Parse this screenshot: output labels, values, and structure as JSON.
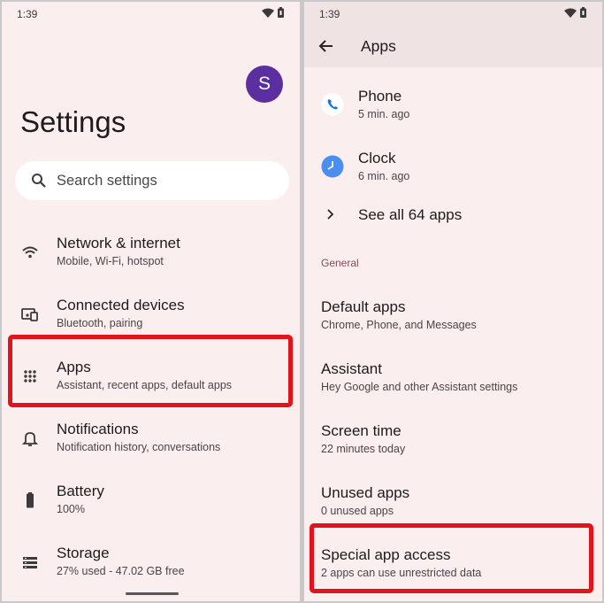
{
  "status": {
    "time": "1:39"
  },
  "left": {
    "avatar_letter": "S",
    "title": "Settings",
    "search_placeholder": "Search settings",
    "items": [
      {
        "icon": "wifi-icon",
        "title": "Network & internet",
        "sub": "Mobile, Wi-Fi, hotspot"
      },
      {
        "icon": "devices-icon",
        "title": "Connected devices",
        "sub": "Bluetooth, pairing"
      },
      {
        "icon": "apps-grid-icon",
        "title": "Apps",
        "sub": "Assistant, recent apps, default apps"
      },
      {
        "icon": "bell-icon",
        "title": "Notifications",
        "sub": "Notification history, conversations"
      },
      {
        "icon": "battery-icon",
        "title": "Battery",
        "sub": "100%"
      },
      {
        "icon": "storage-icon",
        "title": "Storage",
        "sub": "27% used - 47.02 GB free"
      }
    ]
  },
  "right": {
    "title": "Apps",
    "recent": [
      {
        "icon": "phone-app-icon",
        "title": "Phone",
        "sub": "5 min. ago"
      },
      {
        "icon": "clock-app-icon",
        "title": "Clock",
        "sub": "6 min. ago"
      }
    ],
    "see_all": "See all 64 apps",
    "section": "General",
    "items": [
      {
        "title": "Default apps",
        "sub": "Chrome, Phone, and Messages"
      },
      {
        "title": "Assistant",
        "sub": "Hey Google and other Assistant settings"
      },
      {
        "title": "Screen time",
        "sub": "22 minutes today"
      },
      {
        "title": "Unused apps",
        "sub": "0 unused apps"
      },
      {
        "title": "Special app access",
        "sub": "2 apps can use unrestricted data"
      }
    ]
  },
  "colors": {
    "background": "#fbeeee",
    "highlight": "#e0141a",
    "avatar": "#5b2fa0",
    "section": "#8a4a5c"
  }
}
